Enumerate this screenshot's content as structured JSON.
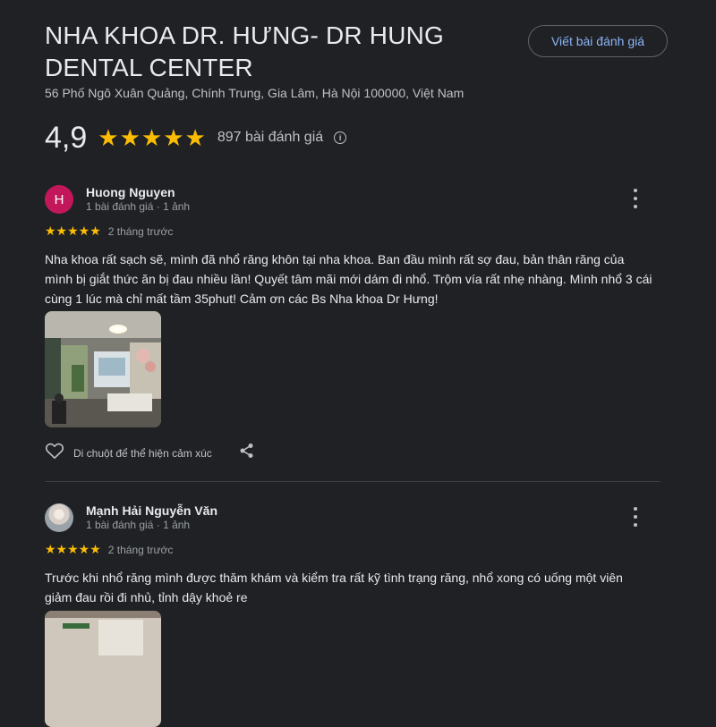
{
  "header": {
    "title": "NHA KHOA DR. HƯNG- DR HUNG DENTAL CENTER",
    "write_review_label": "Viết bài đánh giá",
    "address": "56 Phố Ngô Xuân Quảng, Chính Trung, Gia Lâm, Hà Nội 100000, Việt Nam",
    "rating": "4,9",
    "rating_value": 4.9,
    "stars": "★★★★★",
    "review_count": "897 bài đánh giá",
    "info_icon": "info-icon"
  },
  "reviews": [
    {
      "avatar_letter": "H",
      "author": "Huong Nguyen",
      "meta": "1 bài đánh giá · 1 ảnh",
      "stars": "★★★★★",
      "date": "2 tháng trước",
      "text": "Nha khoa rất sạch sẽ, mình đã nhổ răng khôn tại nha khoa. Ban đầu mình rất sợ đau, bản thân răng của mình bị giắt thức ăn bị đau nhiều lần! Quyết tâm mãi mới dám đi nhổ. Trộm vía rất nhẹ nhàng. Mình nhổ 3 cái cùng 1 lúc mà chỉ mất tầm 35phut! Cảm ơn các Bs Nha khoa Dr Hưng!",
      "like_label": "Di chuột để thể hiện cảm xúc"
    },
    {
      "author": "Mạnh Hải Nguyễn Văn",
      "meta": "1 bài đánh giá · 1 ảnh",
      "stars": "★★★★★",
      "date": "2 tháng trước",
      "text": "Trước khi nhổ răng mình được thăm khám và kiểm tra rất kỹ tình trạng răng, nhổ xong có uống một viên giảm đau rồi đi nhủ, tỉnh dậy khoẻ re"
    }
  ],
  "colors": {
    "background": "#202124",
    "star": "#fbbc04",
    "link": "#8ab4f8",
    "avatar_h": "#c2185b"
  }
}
